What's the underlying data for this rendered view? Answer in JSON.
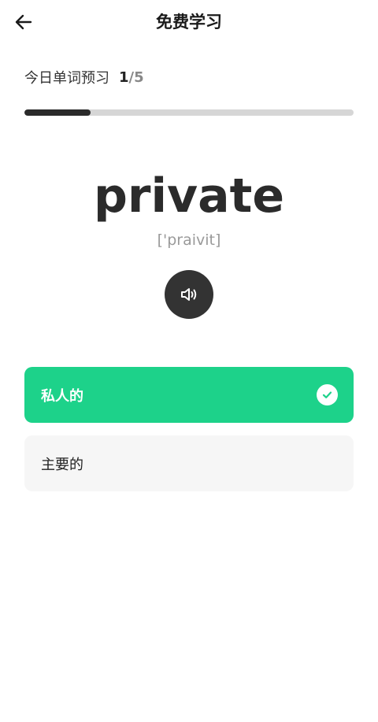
{
  "header": {
    "title": "免费学习",
    "back_icon": "arrow-left-icon"
  },
  "progress": {
    "label": "今日单词预习",
    "current": "1",
    "separator": "/",
    "total": "5",
    "fraction": 0.2
  },
  "word": {
    "text": "private",
    "phonetic": "['praivit]",
    "audio_icon": "speaker-icon"
  },
  "options": [
    {
      "label": "私人的",
      "state": "correct",
      "icon": "check-circle-icon"
    },
    {
      "label": "主要的",
      "state": "default"
    }
  ],
  "colors": {
    "correct": "#1dd28a",
    "option_default_bg": "#f6f6f6",
    "progress_fill": "#2a2a2a",
    "progress_track": "#d6d6d6",
    "audio_button": "#333333"
  }
}
